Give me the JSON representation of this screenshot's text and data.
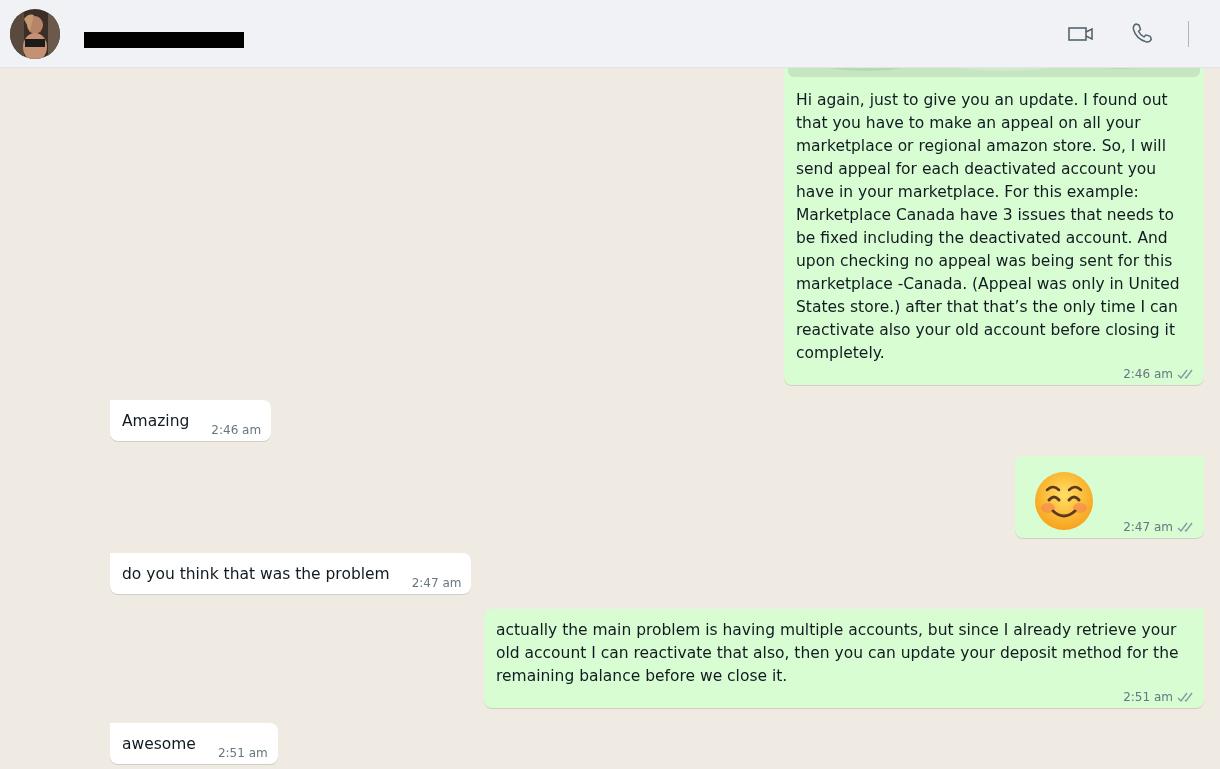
{
  "header": {
    "contact_name_redacted": true
  },
  "messages": [
    {
      "kind": "outgoing",
      "has_image": true,
      "text": "Hi again, just to give you an update. I found out that you have to make an appeal on all your marketplace or regional amazon store. So, I will send appeal for each deactivated account you have in your marketplace. For this example: Marketplace Canada have 3 issues that needs to be fixed including the deactivated account. And upon checking no appeal was being sent for this marketplace -Canada. (Appeal was only in United States store.) after that that’s the only time I can reactivate also your old account before closing it completely.",
      "time": "2:46 am"
    },
    {
      "kind": "incoming",
      "text": "Amazing",
      "time": "2:46 am"
    },
    {
      "kind": "emoji",
      "time": "2:47 am"
    },
    {
      "kind": "incoming",
      "text": "do you think that was the problem",
      "time": "2:47 am"
    },
    {
      "kind": "outgoing",
      "text": "actually the main problem is having multiple accounts, but since I already retrieve your old account I can reactivate that also, then you can update your deposit method for the remaining balance before we close it.",
      "time": "2:51 am"
    },
    {
      "kind": "incoming",
      "text": "awesome",
      "time": "2:51 am"
    }
  ]
}
